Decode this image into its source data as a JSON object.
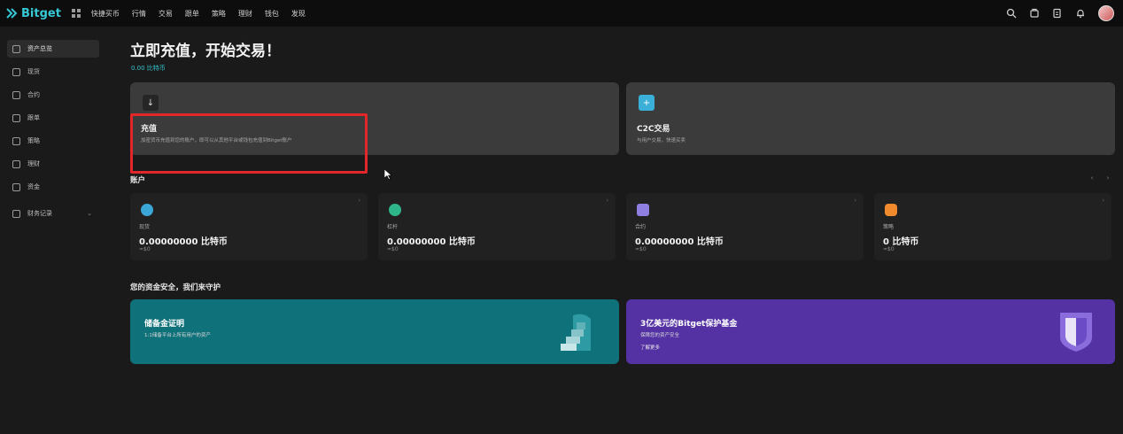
{
  "topbar": {
    "brand": "Bitget",
    "nav": [
      "快捷买币",
      "行情",
      "交易",
      "跟单",
      "策略",
      "理财",
      "钱包",
      "发现"
    ]
  },
  "sidebar": {
    "items": [
      {
        "label": "资产总览",
        "icon": "overview-icon",
        "active": true
      },
      {
        "label": "现货",
        "icon": "tag-icon"
      },
      {
        "label": "合约",
        "icon": "contract-icon"
      },
      {
        "label": "跟单",
        "icon": "copy-trade-icon"
      },
      {
        "label": "策略",
        "icon": "strategy-icon"
      },
      {
        "label": "理财",
        "icon": "earn-icon"
      },
      {
        "label": "资金",
        "icon": "funds-icon"
      },
      {
        "label": "财务记录",
        "icon": "record-icon"
      }
    ]
  },
  "main": {
    "title": "立即充值，开始交易！",
    "sublink": "0.00 比特币",
    "deposit_card": {
      "title": "充值",
      "desc": "加密货币充值到您的账户，即可以从其他平台或钱包充值到Bitget账户"
    },
    "c2c_card": {
      "title": "C2C交易",
      "desc": "与用户交易，快速买卖"
    },
    "accounts_title": "账户",
    "accounts": [
      {
        "name": "现货",
        "balance": "0.00000000 比特币",
        "fiat": "≈$0",
        "color": "#3aa7d6"
      },
      {
        "name": "杠杆",
        "balance": "0.00000000 比特币",
        "fiat": "≈$0",
        "color": "#2fb58a"
      },
      {
        "name": "合约",
        "balance": "0.00000000 比特币",
        "fiat": "≈$0",
        "color": "#8f7fe0"
      },
      {
        "name": "策略",
        "balance": "0 比特币",
        "fiat": "≈$0",
        "color": "#f08a2c"
      }
    ],
    "safety_title": "您的资金安全，我们来守护",
    "banner_reserve": {
      "title": "储备金证明",
      "desc": "1:1储备平台上所有用户的资产"
    },
    "banner_fund": {
      "title": "3亿美元的Bitget保护基金",
      "desc": "保障您的资产安全",
      "link": "了解更多"
    }
  }
}
